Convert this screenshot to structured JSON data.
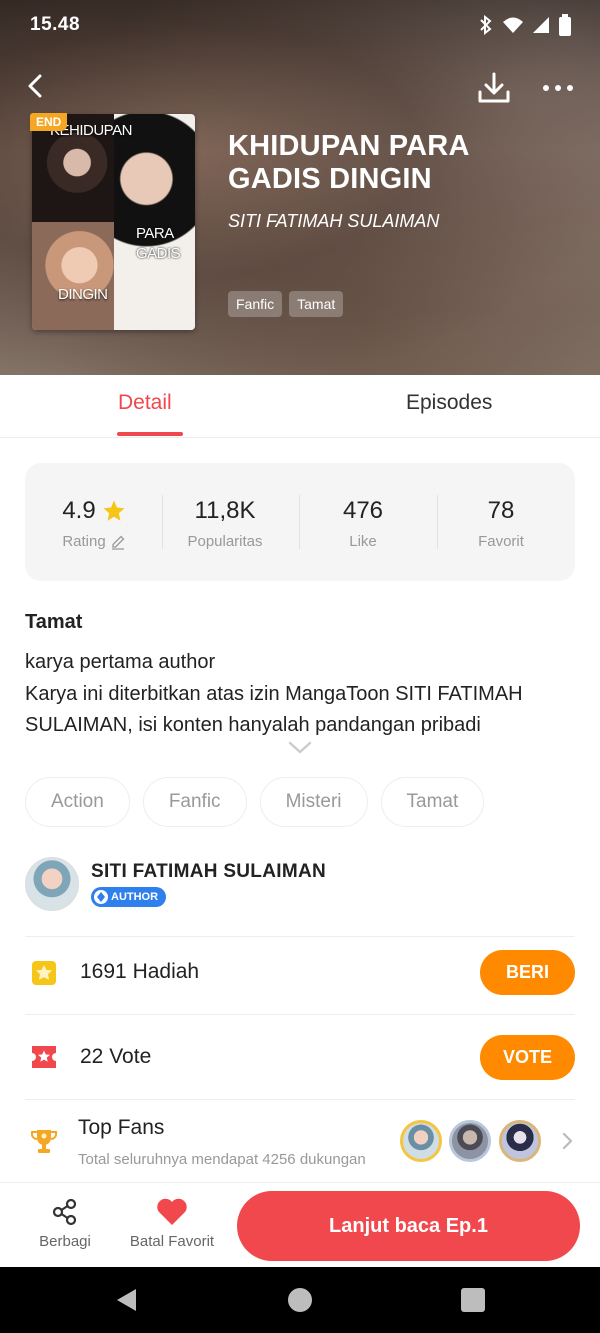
{
  "status_bar": {
    "time": "15.48"
  },
  "book": {
    "badge": "END",
    "title": "KHIDUPAN PARA GADIS DINGIN",
    "author": "SITI FATIMAH SULAIMAN",
    "cover_text_top": "KEHIDUPAN",
    "cover_text_mid": "PARA\nGADIS",
    "cover_text_bottom": "DINGIN",
    "tags": [
      "Fanfic",
      "Tamat"
    ]
  },
  "tabs": {
    "detail": "Detail",
    "episodes": "Episodes"
  },
  "stats": {
    "rating_value": "4.9",
    "rating_label": "Rating",
    "popularity_value": "11,8K",
    "popularity_label": "Popularitas",
    "like_value": "476",
    "like_label": "Like",
    "favorite_value": "78",
    "favorite_label": "Favorit"
  },
  "description": {
    "status": "Tamat",
    "line1": "karya pertama author",
    "line2": "Karya ini diterbitkan atas izin MangaToon SITI FATIMAH SULAIMAN, isi konten hanyalah pandangan pribadi"
  },
  "genres": [
    "Action",
    "Fanfic",
    "Misteri",
    "Tamat"
  ],
  "author_section": {
    "name": "SITI FATIMAH SULAIMAN",
    "badge": "AUTHOR"
  },
  "gifts": {
    "count": "1691",
    "label": "Hadiah",
    "button": "BERI"
  },
  "votes": {
    "count": "22",
    "label": "Vote",
    "button": "VOTE"
  },
  "top_fans": {
    "title": "Top Fans",
    "subtitle": "Total seluruhnya mendapat 4256 dukungan"
  },
  "bottom_bar": {
    "share": "Berbagi",
    "unfavorite": "Batal Favorit",
    "continue": "Lanjut baca Ep.1"
  },
  "colors": {
    "accent": "#f0484c",
    "orange": "#ff8a00",
    "gold": "#f5c542",
    "author_badge": "#2f80ed"
  },
  "icons": [
    "back-arrow-icon",
    "download-icon",
    "more-icon",
    "star-icon",
    "edit-icon",
    "chevron-down-icon",
    "gift-icon",
    "ticket-icon",
    "trophy-icon",
    "chevron-right-icon",
    "share-icon",
    "heart-icon"
  ]
}
